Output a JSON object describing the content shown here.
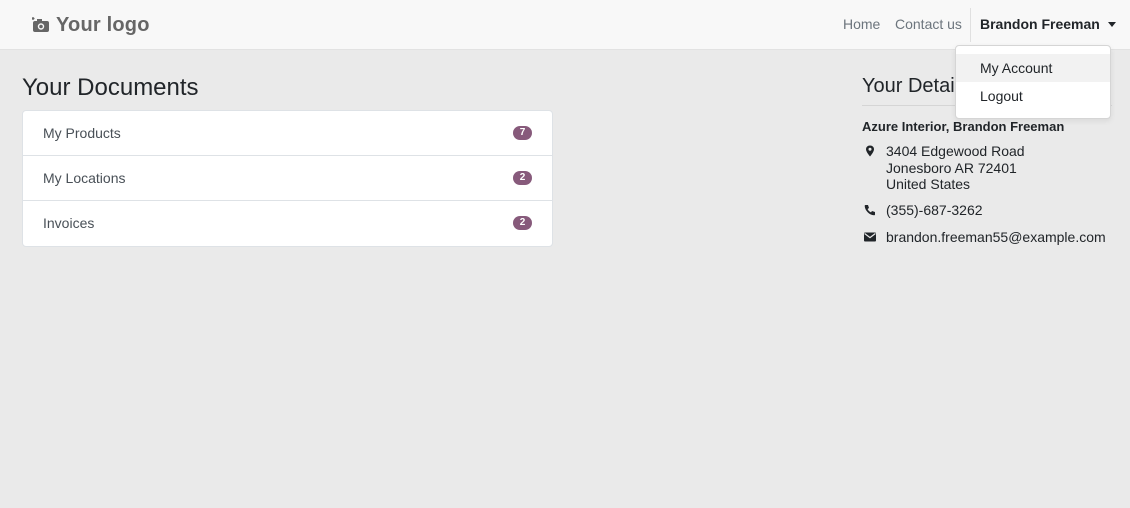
{
  "header": {
    "logo_text": "Your logo",
    "nav": {
      "home": "Home",
      "contact": "Contact us"
    },
    "user_name": "Brandon Freeman"
  },
  "user_menu": {
    "items": [
      {
        "label": "My Account",
        "active": true
      },
      {
        "label": "Logout",
        "active": false
      }
    ]
  },
  "documents": {
    "title": "Your Documents",
    "items": [
      {
        "label": "My Products",
        "count": "7"
      },
      {
        "label": "My Locations",
        "count": "2"
      },
      {
        "label": "Invoices",
        "count": "2"
      }
    ]
  },
  "details": {
    "title": "Your Details",
    "name": "Azure Interior, Brandon Freeman",
    "address": [
      "3404 Edgewood Road",
      "Jonesboro AR 72401",
      "United States"
    ],
    "phone": "(355)-687-3262",
    "email": "brandon.freeman55@example.com"
  },
  "colors": {
    "badge": "#875a7b",
    "background": "#eaeaea",
    "navbar": "#f8f8f8"
  },
  "icons": [
    "camera-logo-icon",
    "caret-down-icon",
    "map-marker-icon",
    "phone-icon",
    "envelope-icon"
  ]
}
